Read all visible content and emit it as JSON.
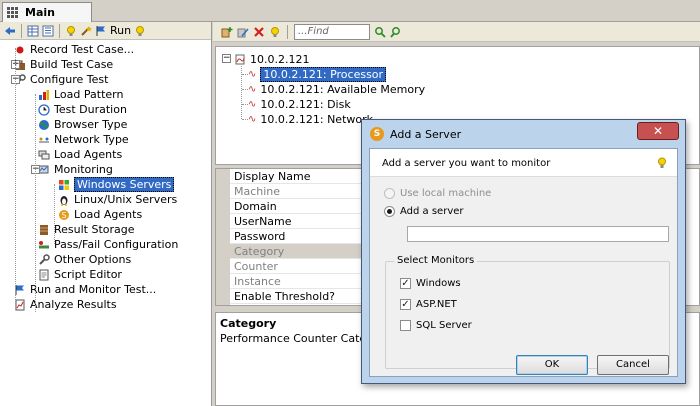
{
  "tab": {
    "label": "Main"
  },
  "left_toolbar": {
    "run_label": "Run"
  },
  "tree": [
    {
      "label": "Record Test Case...",
      "icon": "record-icon",
      "depth": 0,
      "expander": ""
    },
    {
      "label": "Build Test Case",
      "icon": "briefcase-icon",
      "depth": 0,
      "expander": "+"
    },
    {
      "label": "Configure Test",
      "icon": "wrench-icon",
      "depth": 0,
      "expander": "−"
    },
    {
      "label": "Load Pattern",
      "icon": "load-pattern-icon",
      "depth": 1,
      "expander": ""
    },
    {
      "label": "Test Duration",
      "icon": "clock-icon",
      "depth": 1,
      "expander": ""
    },
    {
      "label": "Browser Type",
      "icon": "globe-icon",
      "depth": 1,
      "expander": ""
    },
    {
      "label": "Network Type",
      "icon": "network-icon",
      "depth": 1,
      "expander": ""
    },
    {
      "label": "Load Agents",
      "icon": "agents-icon",
      "depth": 1,
      "expander": ""
    },
    {
      "label": "Monitoring",
      "icon": "monitoring-icon",
      "depth": 1,
      "expander": "−"
    },
    {
      "label": "Windows Servers",
      "icon": "windows-icon",
      "depth": 2,
      "expander": "",
      "selected": true
    },
    {
      "label": "Linux/Unix Servers",
      "icon": "linux-icon",
      "depth": 2,
      "expander": ""
    },
    {
      "label": "Load Agents",
      "icon": "agent-logo-icon",
      "depth": 2,
      "expander": ""
    },
    {
      "label": "Result Storage",
      "icon": "storage-icon",
      "depth": 1,
      "expander": ""
    },
    {
      "label": "Pass/Fail Configuration",
      "icon": "passfail-icon",
      "depth": 1,
      "expander": ""
    },
    {
      "label": "Other Options",
      "icon": "options-icon",
      "depth": 1,
      "expander": ""
    },
    {
      "label": "Script Editor",
      "icon": "script-icon",
      "depth": 1,
      "expander": ""
    },
    {
      "label": "Run and Monitor Test...",
      "icon": "run-flag-icon",
      "depth": 0,
      "expander": ""
    },
    {
      "label": "Analyze Results",
      "icon": "analyze-icon",
      "depth": 0,
      "expander": ""
    }
  ],
  "right_toolbar": {
    "find_placeholder": "...Find"
  },
  "server_tree": {
    "root": "10.0.2.121",
    "counters": [
      {
        "label": "10.0.2.121: Processor",
        "selected": true
      },
      {
        "label": "10.0.2.121: Available Memory"
      },
      {
        "label": "10.0.2.121: Disk"
      },
      {
        "label": "10.0.2.121: Network"
      }
    ]
  },
  "properties": [
    {
      "label": "Display Name",
      "state": "normal"
    },
    {
      "label": "Machine",
      "state": "disabled"
    },
    {
      "label": "Domain",
      "state": "normal"
    },
    {
      "label": "UserName",
      "state": "normal"
    },
    {
      "label": "Password",
      "state": "normal"
    },
    {
      "label": "Category",
      "state": "category"
    },
    {
      "label": "Counter",
      "state": "disabled"
    },
    {
      "label": "Instance",
      "state": "disabled"
    },
    {
      "label": "Enable Threshold?",
      "state": "normal"
    }
  ],
  "description": {
    "title": "Category",
    "text": "Performance Counter Categ"
  },
  "dialog": {
    "title": "Add a Server",
    "close_label": "✕",
    "prompt": "Add a server you want to monitor",
    "use_local": "Use local machine",
    "add_server": "Add a server",
    "server_value": "",
    "monitors_label": "Select Monitors",
    "monitors": [
      {
        "label": "Windows",
        "checked": true
      },
      {
        "label": "ASP.NET",
        "checked": true
      },
      {
        "label": "SQL Server",
        "checked": false
      }
    ],
    "ok_label": "OK",
    "cancel_label": "Cancel"
  },
  "colors": {
    "selection": "#316ac5",
    "dialog_frame": "#bcd3ec",
    "close_button": "#c75050"
  }
}
